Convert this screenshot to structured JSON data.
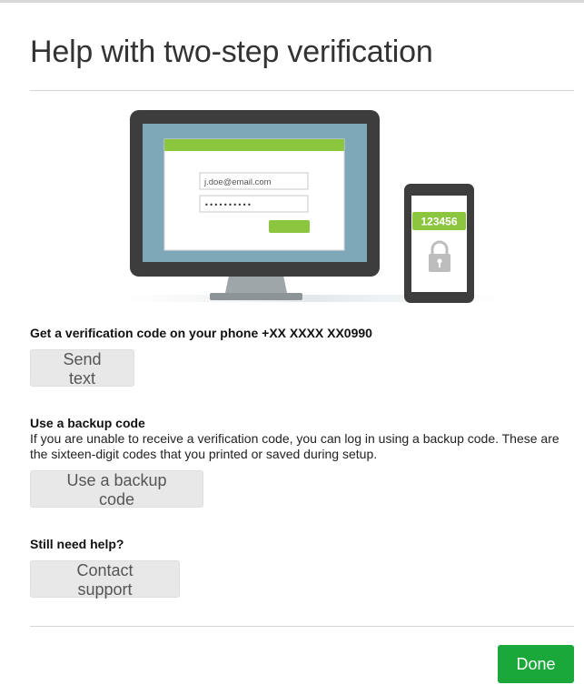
{
  "dialog": {
    "title": "Help with two-step verification"
  },
  "illustration": {
    "email_value": "j.doe@email.com",
    "password_mask": "••••••••••",
    "phone_code": "123456",
    "colors": {
      "accent": "#8cc63f",
      "monitor": "#3d3d3d",
      "screen": "#7ea8b8"
    },
    "icons": [
      "monitor-icon",
      "phone-icon",
      "lock-icon"
    ]
  },
  "verification": {
    "heading": "Get a verification code on your phone +XX XXXX XX0990",
    "button_label": "Send text"
  },
  "backup": {
    "heading": "Use a backup code",
    "description": "If you are unable to receive a verification code, you can log in using a backup code. These are the sixteen-digit codes that you printed or saved during setup.",
    "button_label": "Use a backup code"
  },
  "support": {
    "heading": "Still need help?",
    "button_label": "Contact support"
  },
  "footer": {
    "done_label": "Done",
    "done_color": "#1aa83a"
  }
}
